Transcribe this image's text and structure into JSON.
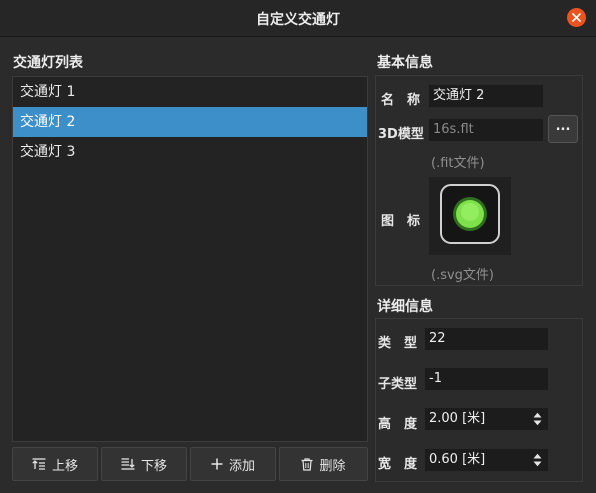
{
  "window": {
    "title": "自定义交通灯",
    "accent_color": "#e95420"
  },
  "left_panel": {
    "title": "交通灯列表",
    "items": [
      {
        "label": "交通灯 1",
        "selected": false
      },
      {
        "label": "交通灯 2",
        "selected": true
      },
      {
        "label": "交通灯 3",
        "selected": false
      }
    ],
    "selection_color": "#3d8fca",
    "buttons": [
      {
        "label": "上移",
        "icon": "move-up-icon"
      },
      {
        "label": "下移",
        "icon": "move-down-icon"
      },
      {
        "label": "添加",
        "icon": "plus-icon"
      },
      {
        "label": "删除",
        "icon": "trash-icon"
      }
    ]
  },
  "basic_info": {
    "title": "基本信息",
    "name_label": "名　称",
    "name_value": "交通灯 2",
    "model_label": "3D模型",
    "model_value": "16s.flt",
    "browse_label": "...",
    "model_hint": "(.fit文件)",
    "icon_label": "图　标",
    "icon_hint": "(.svg文件)",
    "icon_color": "#7ee04a"
  },
  "detail_info": {
    "title": "详细信息",
    "type_label": "类　型",
    "type_value": "22",
    "subtype_label": "子类型",
    "subtype_value": "-1",
    "height_label": "高　度",
    "height_value": "2.00 [米]",
    "width_label": "宽　度",
    "width_value": "0.60 [米]"
  }
}
